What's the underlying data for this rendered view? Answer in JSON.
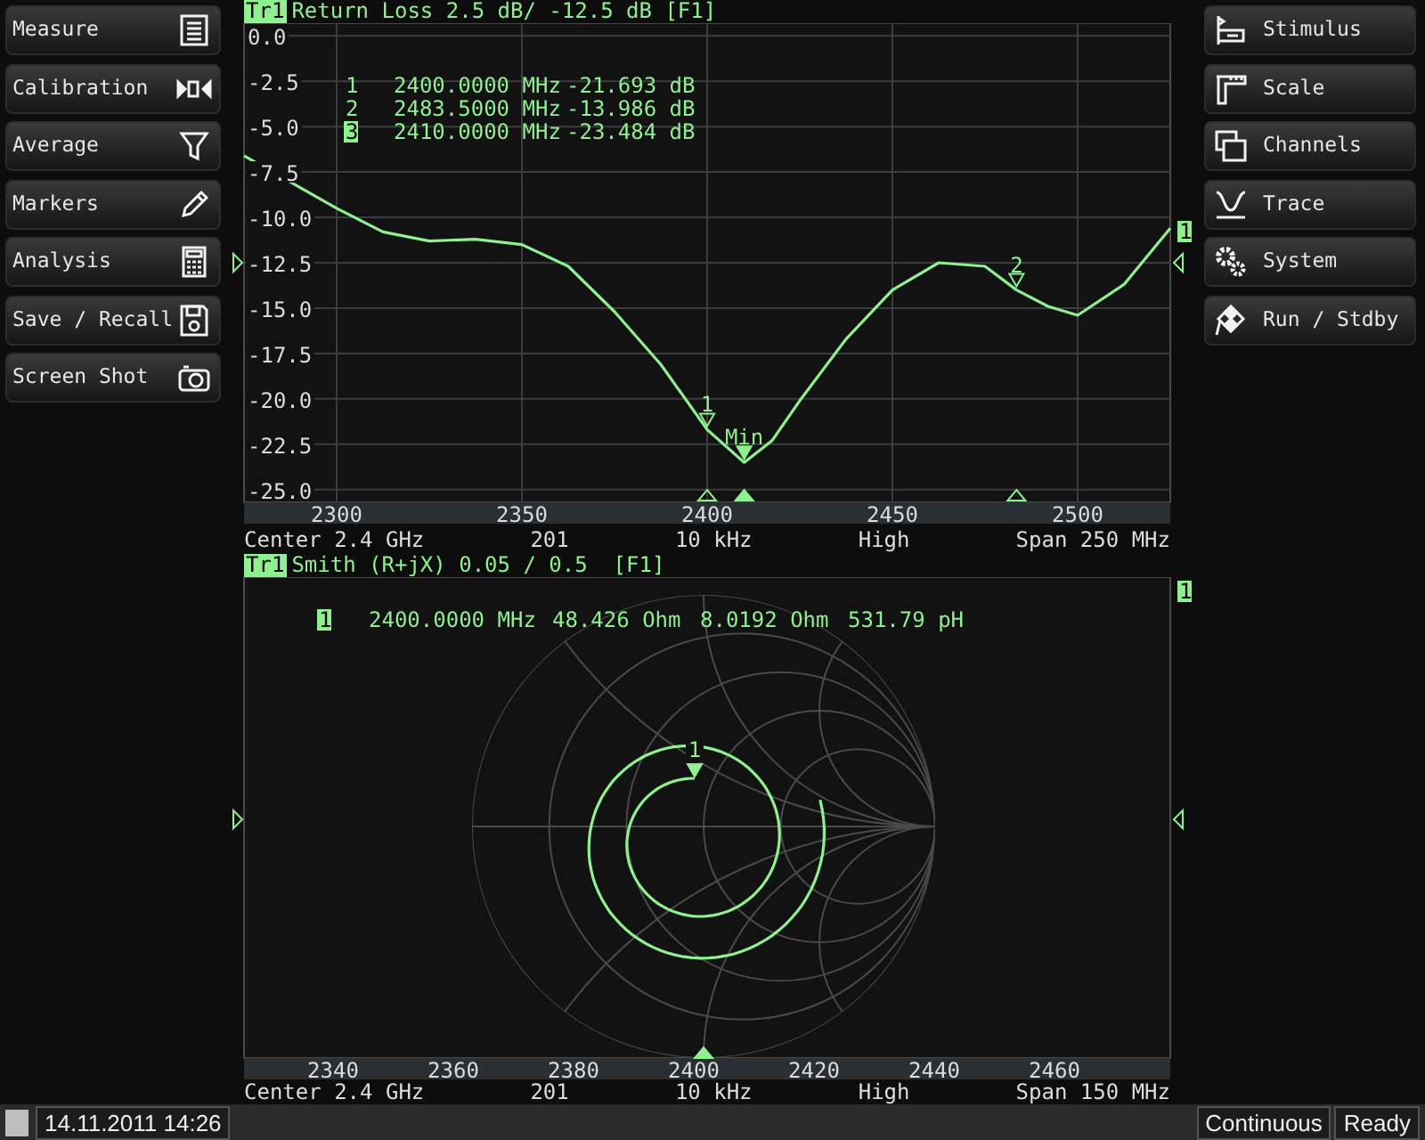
{
  "left_menu": [
    {
      "label": "Measure"
    },
    {
      "label": "Calibration"
    },
    {
      "label": "Average"
    },
    {
      "label": "Markers"
    },
    {
      "label": "Analysis"
    },
    {
      "label": "Save / Recall"
    },
    {
      "label": "Screen Shot"
    }
  ],
  "right_menu": [
    {
      "label": "Stimulus"
    },
    {
      "label": "Scale"
    },
    {
      "label": "Channels"
    },
    {
      "label": "Trace"
    },
    {
      "label": "System"
    },
    {
      "label": "Run / Stdby"
    }
  ],
  "trace1": {
    "trace_tag": "Tr1",
    "title": "Return Loss 2.5 dB/ -12.5 dB [F1]",
    "right_badge": "1",
    "marker_table": [
      {
        "number": "1",
        "frequency": "2400.0000 MHz",
        "value": "-21.693 dB",
        "selected": false
      },
      {
        "number": "2",
        "frequency": "2483.5000 MHz",
        "value": "-13.986 dB",
        "selected": false
      },
      {
        "number": "3",
        "frequency": "2410.0000 MHz",
        "value": "-23.484 dB",
        "selected": true
      }
    ],
    "chart_data": {
      "type": "line",
      "grid": true,
      "xlim": [
        2275,
        2525
      ],
      "ylim": [
        -25.7,
        0.7
      ],
      "xticks": [
        2300,
        2350,
        2400,
        2450,
        2500
      ],
      "yticks": [
        {
          "value": 0,
          "label": "0.0"
        },
        {
          "value": -2.5,
          "label": "-2.5"
        },
        {
          "value": -5,
          "label": "-5.0"
        },
        {
          "value": -7.5,
          "label": "-7.5"
        },
        {
          "value": -10,
          "label": "-10.0"
        },
        {
          "value": -12.5,
          "label": "-12.5"
        },
        {
          "value": -15,
          "label": "-15.0"
        },
        {
          "value": -17.5,
          "label": "-17.5"
        },
        {
          "value": -20,
          "label": "-20.0"
        },
        {
          "value": -22.5,
          "label": "-22.5"
        },
        {
          "value": -25,
          "label": "-25.0"
        }
      ],
      "x": [
        2275,
        2300,
        2312.5,
        2325,
        2337.5,
        2350,
        2362.5,
        2375,
        2387.5,
        2400,
        2410,
        2417.5,
        2425,
        2437.5,
        2450,
        2462.5,
        2475,
        2483.5,
        2492,
        2500,
        2512.5,
        2525
      ],
      "series": [
        {
          "color": "#8ef08e",
          "values": [
            -6.6,
            -9.5,
            -10.8,
            -11.3,
            -11.2,
            -11.5,
            -12.7,
            -15.2,
            -18.1,
            -21.7,
            -23.5,
            -22.3,
            -20.1,
            -16.7,
            -14.0,
            -12.5,
            -12.7,
            -14.0,
            -14.9,
            -15.4,
            -13.7,
            -10.6
          ]
        }
      ],
      "annotations": [
        {
          "x": 2400,
          "y": -21.7,
          "text": "1"
        },
        {
          "x": 2483.5,
          "y": -14.0,
          "text": "2"
        },
        {
          "x": 2410,
          "y": -23.5,
          "text": "Min"
        }
      ]
    },
    "footer": [
      "Center 2.4 GHz",
      "201",
      "10 kHz",
      "High",
      "Span 250 MHz"
    ]
  },
  "trace2": {
    "trace_tag": "Tr1",
    "title": "Smith (R+jX) 0.05 / 0.5  [F1]",
    "right_badge": "1",
    "readout": {
      "number": "1",
      "frequency": "2400.0000 MHz",
      "resistance": "48.426 Ohm",
      "reactance": "8.0192 Ohm",
      "inductance": "531.79 pH"
    },
    "trace_marker": "1",
    "x_axis_labels": [
      "2340",
      "2360",
      "2380",
      "2400",
      "2420",
      "2440",
      "2460"
    ],
    "footer": [
      "Center 2.4 GHz",
      "201",
      "10 kHz",
      "High",
      "Span 150 MHz"
    ]
  },
  "status_bar": {
    "datetime": "14.11.2011 14:26",
    "sweep_mode": "Continuous",
    "state": "Ready"
  }
}
